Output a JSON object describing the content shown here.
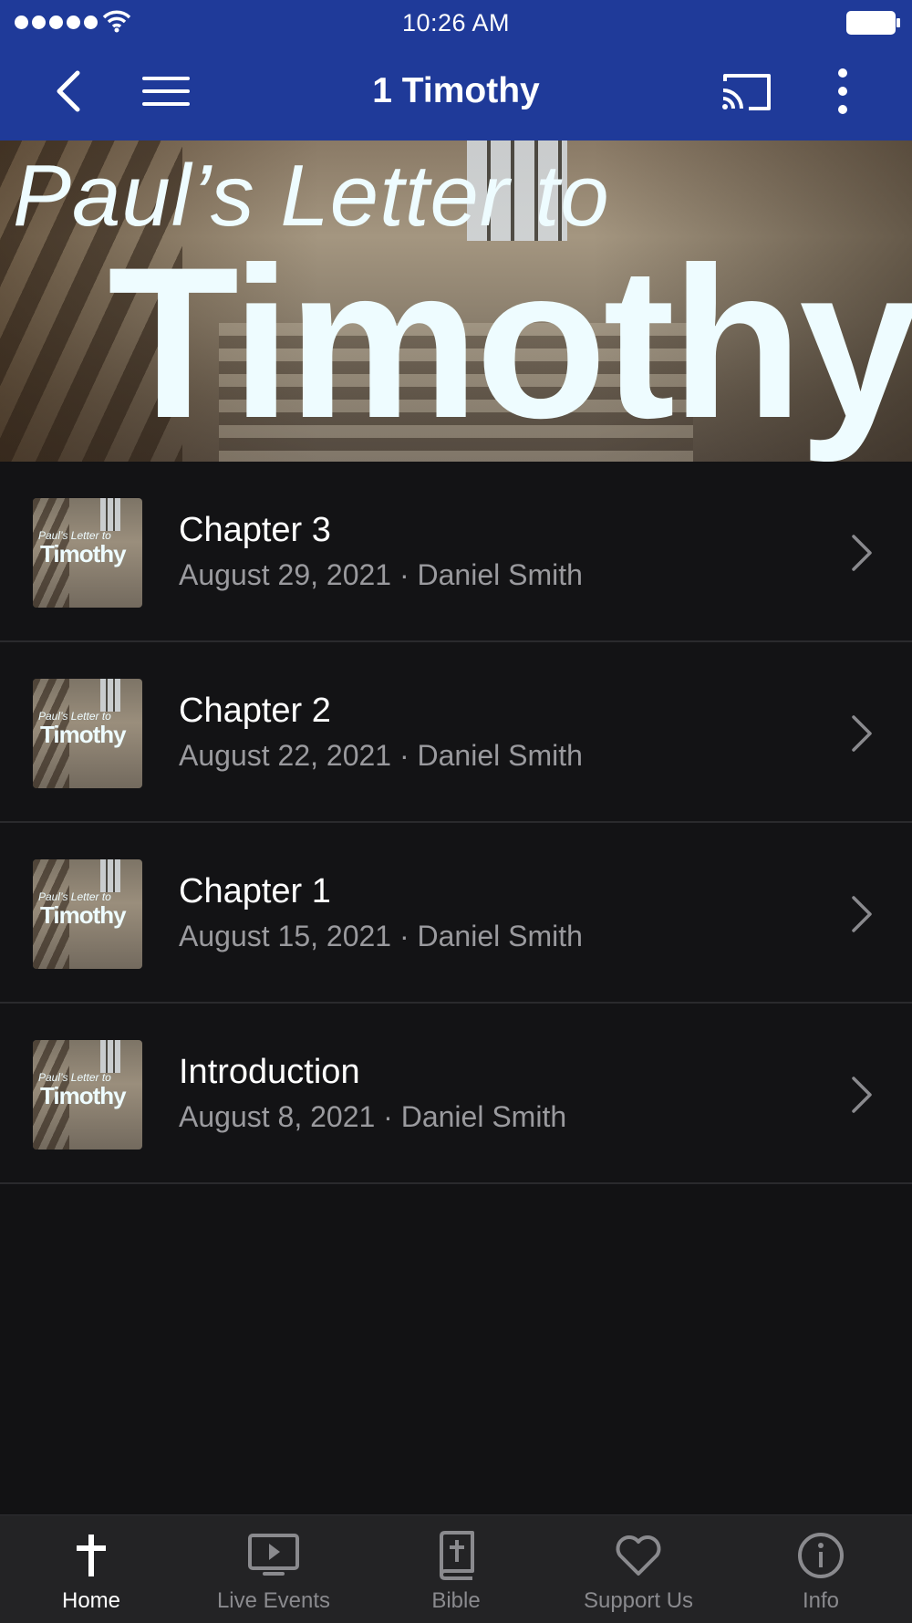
{
  "status_bar": {
    "time": "10:26 AM"
  },
  "nav": {
    "title": "1 Timothy",
    "back_icon": "chevron-left-icon",
    "menu_icon": "hamburger-icon",
    "cast_icon": "cast-icon",
    "more_icon": "more-vertical-icon"
  },
  "hero": {
    "line1": "Paul’s Letter to",
    "line2": "Timothy"
  },
  "thumbnail": {
    "line1": "Paul’s Letter to",
    "line2": "Timothy"
  },
  "items": [
    {
      "title": "Chapter 3",
      "subtitle": "August 29, 2021 · Daniel Smith"
    },
    {
      "title": "Chapter 2",
      "subtitle": "August 22, 2021 · Daniel Smith"
    },
    {
      "title": "Chapter 1",
      "subtitle": "August 15, 2021 · Daniel Smith"
    },
    {
      "title": "Introduction",
      "subtitle": "August 8, 2021 · Daniel Smith"
    }
  ],
  "tabs": [
    {
      "label": "Home",
      "icon": "cross-icon",
      "active": true
    },
    {
      "label": "Live Events",
      "icon": "play-screen-icon",
      "active": false
    },
    {
      "label": "Bible",
      "icon": "bible-icon",
      "active": false
    },
    {
      "label": "Support Us",
      "icon": "heart-icon",
      "active": false
    },
    {
      "label": "Info",
      "icon": "info-icon",
      "active": false
    }
  ],
  "colors": {
    "header": "#1f3a99",
    "background": "#121214",
    "tabbar": "#232325",
    "subtitle": "#9a9a9e"
  }
}
